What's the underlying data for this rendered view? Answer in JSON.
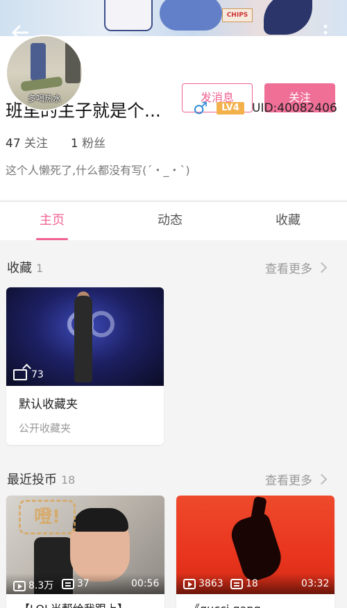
{
  "header": {
    "avatar_caption": "多喝热水",
    "back_icon": "back-arrow-icon",
    "more_icon": "more-vertical-icon"
  },
  "actions": {
    "message_label": "发消息",
    "follow_label": "关注"
  },
  "profile": {
    "username": "班里的主子就是个...",
    "gender_symbol": "♂",
    "level_badge": "LV4",
    "uid": "UID:40082406",
    "following_count": "47",
    "following_label": "关注",
    "fans_count": "1",
    "fans_label": "粉丝",
    "bio": "这个人懒死了,什么都没有写(´・_・`)"
  },
  "tabs": [
    {
      "label": "主页",
      "active": true
    },
    {
      "label": "动态",
      "active": false
    },
    {
      "label": "收藏",
      "active": false
    }
  ],
  "favorites": {
    "title": "收藏",
    "count": "1",
    "see_more": "查看更多",
    "items": [
      {
        "count": "73",
        "name": "默认收藏夹",
        "subtitle": "公开收藏夹"
      }
    ]
  },
  "recent_coins": {
    "title": "最近投币",
    "count": "18",
    "see_more": "查看更多",
    "items": [
      {
        "plays": "8.3万",
        "danmaku": "37",
        "duration": "00:56",
        "sticker": "噔!",
        "title": "【LOL当帮给我跟上】"
      },
      {
        "plays": "3863",
        "danmaku": "18",
        "duration": "03:32",
        "title": "《gucci gang"
      }
    ]
  },
  "colors": {
    "accent_pink": "#f06292",
    "follow_button": "#f06f97",
    "gender_blue": "#3a8fd8",
    "level_badge": "#f3b14c"
  }
}
